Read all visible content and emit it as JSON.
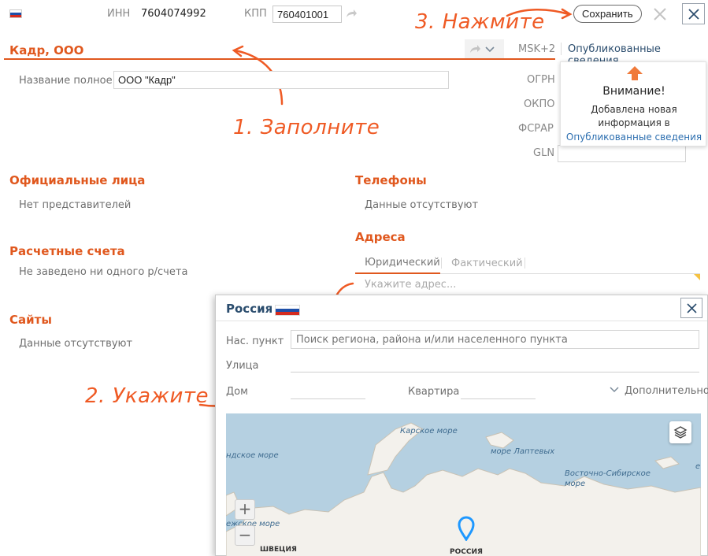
{
  "header": {
    "inn_label": "ИНН",
    "inn_value": "7604074992",
    "kpp_label": "КПП",
    "kpp_value": "760401001",
    "save_label": "Сохранить"
  },
  "org": {
    "short_name": "Кадр, ООО",
    "timezone": "MSK+2",
    "published_link": "Опубликованные сведения",
    "full_name_label": "Название полное",
    "full_name_value": "ООО \"Кадр\""
  },
  "codes": {
    "ogrn_label": "ОГРН",
    "okpo_label": "ОКПО",
    "fsrar_label": "ФСРАР",
    "gln_label": "GLN"
  },
  "notice": {
    "title": "Внимание!",
    "line1": "Добавлена новая",
    "line2": "информация в",
    "link": "Опубликованные сведения"
  },
  "sections": {
    "officials_title": "Официальные лица",
    "officials_empty": "Нет представителей",
    "accounts_title": "Расчетные счета",
    "accounts_empty": "Не заведено ни одного р/счета",
    "sites_title": "Сайты",
    "sites_empty": "Данные отсутствуют",
    "phones_title": "Телефоны",
    "phones_empty": "Данные отсутствуют",
    "addresses_title": "Адреса",
    "addr_tab_legal": "Юридический",
    "addr_tab_actual": "Фактический",
    "addr_placeholder": "Укажите адрес..."
  },
  "modal": {
    "country": "Россия",
    "locality_label": "Нас. пункт",
    "locality_placeholder": "Поиск региона, района и/или населенного пункта",
    "street_label": "Улица",
    "house_label": "Дом",
    "flat_label": "Квартира",
    "more_label": "Дополнительно"
  },
  "map": {
    "labels": {
      "kara_sea": "Карское море",
      "laptev_sea": "море Лаптевых",
      "east_siberian_sea": "Восточно-Сибирское море",
      "norwegian_sea": "ндское море",
      "sea_left": "ежское море",
      "sweden": "ШВЕЦИЯ",
      "russia": "РОССИЯ",
      "e_edge": "е"
    },
    "zoom_in": "+",
    "zoom_out": "−",
    "colors": {
      "water": "#b5d0e1",
      "land": "#f3f1ec",
      "pin": "#1e98ff"
    }
  },
  "annotations": {
    "step1": "1. Заполните",
    "step2": "2. Укажите",
    "step3": "3. Нажмите"
  },
  "colors": {
    "accent": "#e0581e",
    "link": "#2d6fb0",
    "callout": "#ef5a24"
  }
}
